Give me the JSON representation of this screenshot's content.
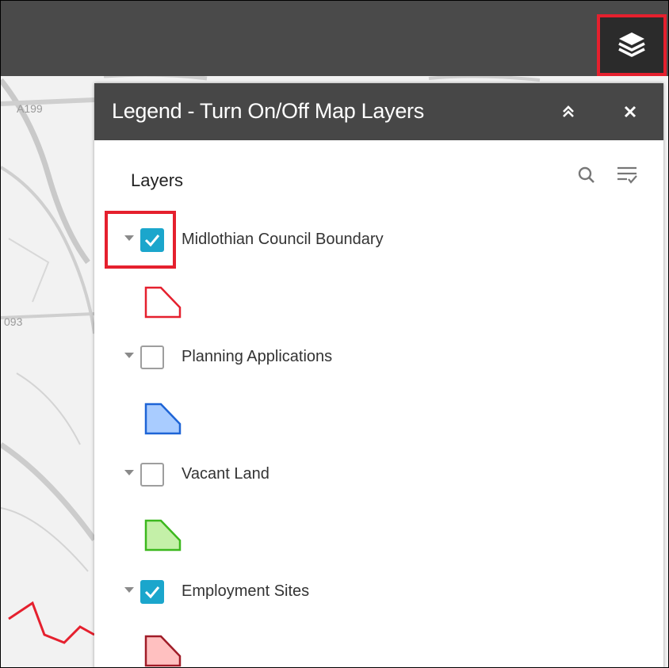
{
  "toolbar": {
    "layers_icon": "layers-stack-icon"
  },
  "map": {
    "road_labels": [
      "A199",
      "093"
    ],
    "boundary_color": "#e5202e"
  },
  "legend_panel": {
    "title": "Legend - Turn On/Off Map Layers",
    "collapse_icon": "double-chevron-up-icon",
    "close_icon": "close-icon",
    "layers_heading": "Layers",
    "search_icon": "search-icon",
    "filter_icon": "filter-list-icon",
    "layers": [
      {
        "label": "Midlothian Council Boundary",
        "checked": true,
        "fill": "#ffffff",
        "stroke": "#e5202e"
      },
      {
        "label": "Planning Applications",
        "checked": false,
        "fill": "#a9ccff",
        "stroke": "#1e64d6"
      },
      {
        "label": "Vacant Land",
        "checked": false,
        "fill": "#c4f0a8",
        "stroke": "#3cb81e"
      },
      {
        "label": "Employment Sites",
        "checked": true,
        "fill": "#ffc0c0",
        "stroke": "#a01c28"
      }
    ]
  },
  "colors": {
    "header_bg": "#474747",
    "checkbox_on": "#1ba6cc",
    "highlight": "#e5202e"
  }
}
